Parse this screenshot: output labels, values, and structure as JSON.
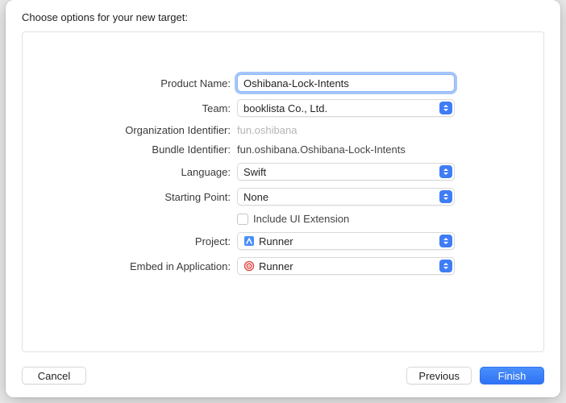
{
  "header": "Choose options for your new target:",
  "labels": {
    "productName": "Product Name:",
    "team": "Team:",
    "orgId": "Organization Identifier:",
    "bundleId": "Bundle Identifier:",
    "language": "Language:",
    "startingPoint": "Starting Point:",
    "includeUIExt": "Include UI Extension",
    "project": "Project:",
    "embed": "Embed in Application:"
  },
  "values": {
    "productName": "Oshibana-Lock-Intents",
    "team": "booklista Co., Ltd.",
    "orgId": "fun.oshibana",
    "bundleId": "fun.oshibana.Oshibana-Lock-Intents",
    "language": "Swift",
    "startingPoint": "None",
    "project": "Runner",
    "embed": "Runner"
  },
  "buttons": {
    "cancel": "Cancel",
    "previous": "Previous",
    "finish": "Finish"
  }
}
